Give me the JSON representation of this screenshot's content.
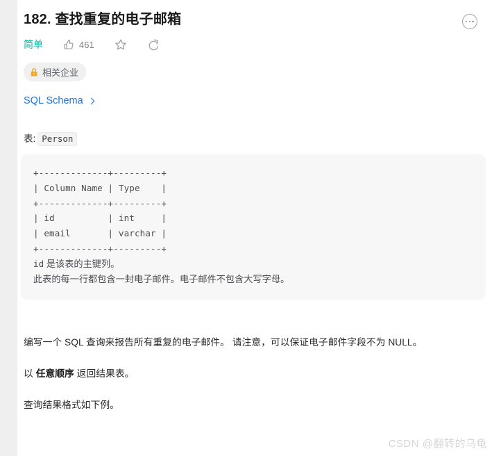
{
  "header": {
    "title": "182. 查找重复的电子邮箱",
    "more_icon": "more-options-icon"
  },
  "meta": {
    "difficulty": "简单",
    "difficulty_color": "#00b8a3",
    "like": {
      "icon": "thumbs-up-icon",
      "count": "461"
    },
    "favorite": {
      "icon": "star-icon"
    },
    "share": {
      "icon": "share-icon"
    }
  },
  "company_badge": {
    "icon": "lock-icon",
    "icon_color": "#f5a623",
    "label": "相关企业"
  },
  "schema_link": {
    "label": "SQL Schema",
    "chevron": "chevron-right-icon",
    "color": "#1a73e8"
  },
  "table_section": {
    "caption_prefix": "表:",
    "table_name": "Person",
    "code": "+-------------+---------+\n| Column Name | Type    |\n+-------------+---------+\n| id          | int     |\n| email       | varchar |\n+-------------+---------+",
    "note_line1_code": "id",
    "note_line1_text": " 是该表的主键列。",
    "note_line2": "此表的每一行都包含一封电子邮件。电子邮件不包含大写字母。"
  },
  "description": {
    "paragraph1": "编写一个 SQL 查询来报告所有重复的电子邮件。 请注意，可以保证电子邮件字段不为 NULL。",
    "paragraph2_prefix": "以 ",
    "paragraph2_bold": "任意顺序",
    "paragraph2_suffix": " 返回结果表。",
    "paragraph3": "查询结果格式如下例。"
  },
  "watermark": {
    "text": "CSDN @翻转的乌龟"
  }
}
